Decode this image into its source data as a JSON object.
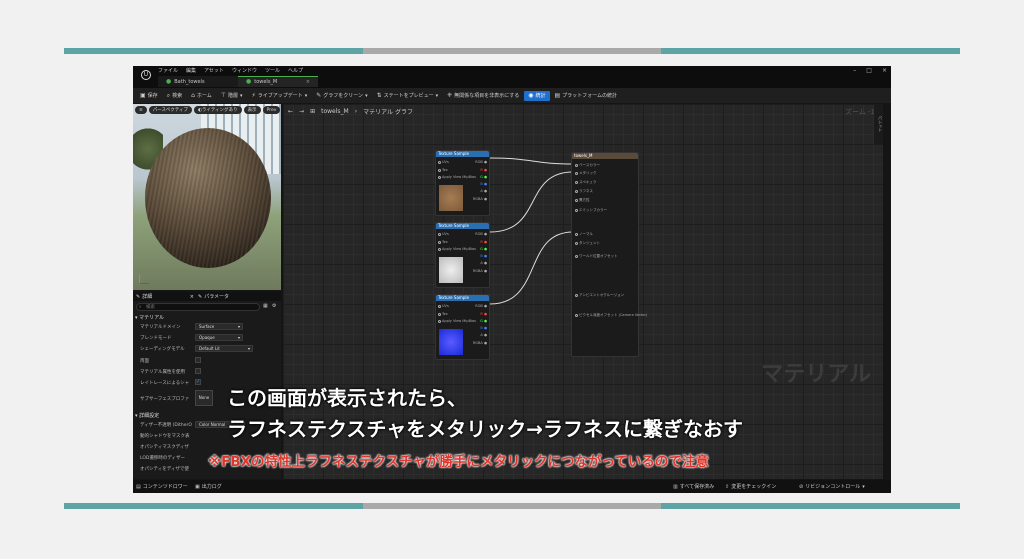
{
  "colors": {
    "teal": "#5fa4a4",
    "grey": "#a9a9a9",
    "accent": "#1f6fcf",
    "red": "#e0352b"
  },
  "menu": {
    "items": [
      "ファイル",
      "編集",
      "アセット",
      "ウィンドウ",
      "ツール",
      "ヘルプ"
    ]
  },
  "tabs": [
    {
      "label": "Bath_towels"
    },
    {
      "label": "towels_M"
    }
  ],
  "window_controls": {
    "minimize": "–",
    "maximize": "□",
    "close": "×"
  },
  "toolbar": {
    "save": "保存",
    "browse": "検索",
    "home": "ホーム",
    "hierarchy": "階層",
    "live_update": "ライブアップデート",
    "clean_graph": "グラフをクリーン",
    "preview_state": "ステートをプレビュー",
    "hide_unrelated": "無関係な項目を非表示にする",
    "stats": "統計",
    "platform_stats": "プラットフォームの統計"
  },
  "viewport": {
    "perspective": "パースペクティブ",
    "lighting": "ライティングあり",
    "show": "表示",
    "prev": "Prev"
  },
  "graph": {
    "path": "towels_M",
    "section": "マテリアル グラフ",
    "zoom": "ズーム -1",
    "watermark": "マテリアル",
    "side_tab": "パレット"
  },
  "details": {
    "tab_details": "詳細",
    "tab_params": "パラメータ",
    "search_placeholder": "検索",
    "section_material": "マテリアル",
    "domain_label": "マテリアルドメイン",
    "domain_value": "Surface",
    "blend_label": "ブレンドモード",
    "blend_value": "Opaque",
    "shading_label": "シェーディングモデル",
    "shading_value": "Default Lit",
    "twosided_label": "両面",
    "usematattr_label": "マテリアル属性を使用",
    "raytrace_label": "レイトレースによるシャ",
    "subsurface_label": "サブサーフェスプロファ",
    "subsurface_value": "None",
    "section_advanced": "詳細設定",
    "dither_label": "ディザー不透明 (DitherO",
    "dither_value": "Color Normal",
    "shadow_label": "動的シャドウをマスク表",
    "opacity_label": "オパシティマスクディザ",
    "lod_label": "LOD遷移時のディザー",
    "opacitysep_label": "オパシティをディザで使"
  },
  "bottom": {
    "content_drawer": "コンテンツドロワー",
    "output_log": "出力ログ",
    "save_all": "すべて保存済み",
    "check_in": "変更をチェックイン",
    "source_control": "リビジョンコントロール"
  },
  "nodes": {
    "texture_sample": "Texture Sample",
    "uvs": "UVs",
    "tex": "Tex",
    "apply_mip": "Apply View MipBias",
    "rgb": "RGB",
    "r": "R",
    "g": "G",
    "b": "B",
    "a": "A",
    "rgba": "RGBA"
  },
  "result_node": {
    "title": "towels_M",
    "pins": [
      "ベースカラー",
      "メタリック",
      "スペキュラ",
      "ラフネス",
      "異方性",
      "エミッシブカラー",
      "ノーマル",
      "タンジェント",
      "ワールド位置オフセット",
      "アンビエントオクルージョン",
      "ピクセル深度オフセット (Camera Vector)"
    ]
  },
  "captions": {
    "line1": "この画面が表示されたら、",
    "line2": "ラフネステクスチャをメタリック→ラフネスに繋ぎなおす",
    "line3": "※FBXの特性上ラフネステクスチャが勝手にメタリックにつながっているので注意"
  }
}
